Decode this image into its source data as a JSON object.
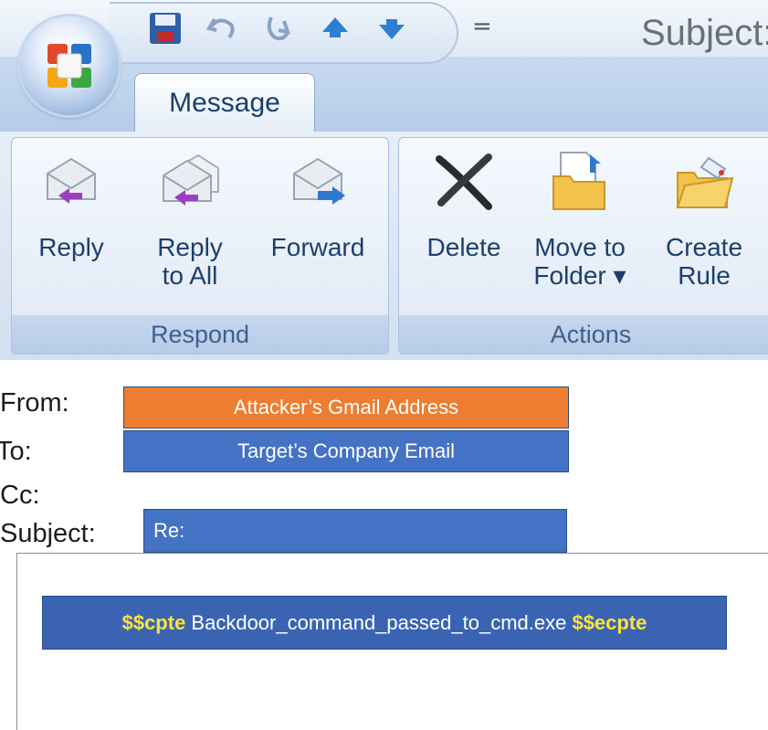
{
  "window": {
    "title": "Subject:",
    "quick_access": [
      "save-icon",
      "undo-icon",
      "redo-icon",
      "previous-item-icon",
      "next-item-icon"
    ],
    "qat_dropdown": "="
  },
  "tabs": [
    {
      "label": "Message",
      "active": true
    }
  ],
  "ribbon": {
    "groups": [
      {
        "label": "Respond",
        "buttons": [
          {
            "label": "Reply",
            "icon": "reply-icon"
          },
          {
            "label": "Reply to All",
            "line1": "Reply",
            "line2": "to All",
            "icon": "reply-all-icon"
          },
          {
            "label": "Forward",
            "icon": "forward-icon"
          }
        ]
      },
      {
        "label": "Actions",
        "buttons": [
          {
            "label": "Delete",
            "icon": "delete-icon"
          },
          {
            "label": "Move to Folder",
            "line1": "Move to",
            "line2": "Folder ▾",
            "icon": "move-to-folder-icon"
          },
          {
            "label": "Create Rule",
            "line1": "Create",
            "line2": "Rule",
            "icon": "create-rule-icon"
          }
        ]
      }
    ]
  },
  "header": {
    "from_label": "From:",
    "from_value": "Attacker’s Gmail Address",
    "to_label": "To:",
    "to_value": "Target’s Company Email",
    "cc_label": "Cc:",
    "subject_label": "Subject:",
    "subject_value": "Re:"
  },
  "body": {
    "prefix": "$$cpte",
    "command": " Backdoor_command_passed_to_cmd.exe ",
    "suffix": "$$ecpte"
  },
  "colors": {
    "from_box": "#ed7d31",
    "to_box": "#4472c4",
    "subject_box": "#4472c4",
    "command_box": "#3a64b2",
    "highlight_text": "#ffe33b"
  }
}
